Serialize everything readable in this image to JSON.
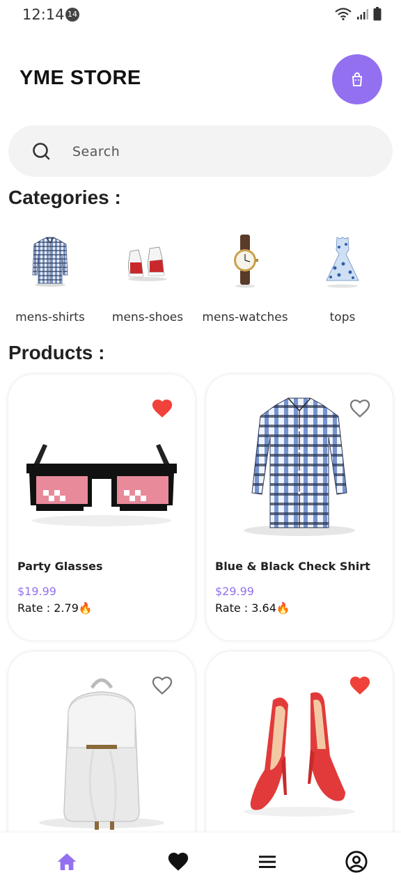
{
  "status_bar": {
    "time": "12:14",
    "notification_count": "14"
  },
  "header": {
    "title": "YME STORE"
  },
  "search": {
    "placeholder": "Search"
  },
  "categories": {
    "title": "Categories :",
    "items": [
      {
        "label": "mens-shirts"
      },
      {
        "label": "mens-shoes"
      },
      {
        "label": "mens-watches"
      },
      {
        "label": "tops"
      }
    ]
  },
  "products": {
    "title": "Products :",
    "items": [
      {
        "name": "Party Glasses",
        "price": "$19.99",
        "rate": "Rate : 2.79🔥",
        "favorite": true
      },
      {
        "name": "Blue & Black Check Shirt",
        "price": "$29.99",
        "rate": "Rate : 3.64🔥",
        "favorite": false
      },
      {
        "name": "",
        "price": "",
        "rate": "",
        "favorite": false
      },
      {
        "name": "",
        "price": "",
        "rate": "",
        "favorite": true
      }
    ]
  },
  "colors": {
    "accent": "#9370f0",
    "heart_red": "#f0423a",
    "search_bg": "#f3f3f3"
  },
  "bottom_nav": {
    "items": [
      {
        "icon": "home-icon",
        "active": true
      },
      {
        "icon": "heart-icon",
        "active": false
      },
      {
        "icon": "menu-icon",
        "active": false
      },
      {
        "icon": "profile-icon",
        "active": false
      }
    ]
  }
}
